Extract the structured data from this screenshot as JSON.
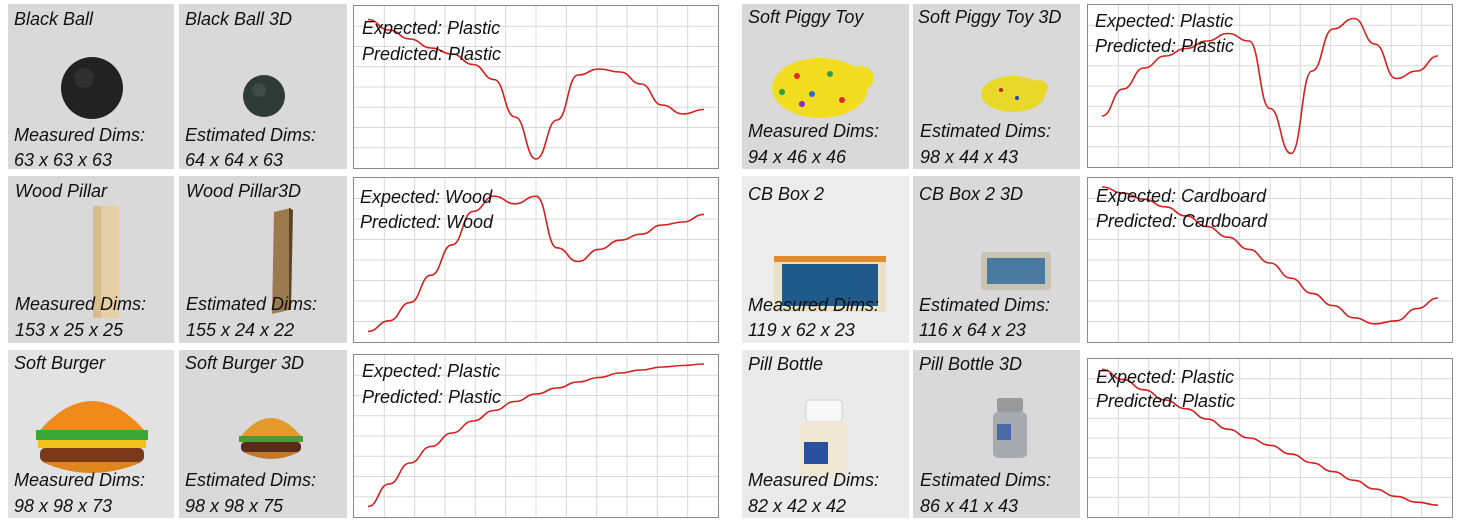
{
  "colors": {
    "curve": "#d42020",
    "grid": "#d8d8d8",
    "tile_bg": "#d9d9d9"
  },
  "rows": [
    {
      "photo": {
        "title": "Black Ball",
        "dims_label": "Measured Dims:",
        "dims": "63 x 63 x 63"
      },
      "recon": {
        "title": "Black Ball 3D",
        "dims_label": "Estimated Dims:",
        "dims": "64 x 64 x 63"
      },
      "chart": {
        "expected": "Expected: Plastic",
        "predicted": "Predicted: Plastic"
      }
    },
    {
      "photo": {
        "title": "Soft Piggy Toy",
        "dims_label": "Measured Dims:",
        "dims": "94 x 46 x 46"
      },
      "recon": {
        "title": "Soft Piggy Toy 3D",
        "dims_label": "Estimated Dims:",
        "dims": "98 x 44 x 43"
      },
      "chart": {
        "expected": "Expected: Plastic",
        "predicted": "Predicted: Plastic"
      }
    },
    {
      "photo": {
        "title": "Wood Pillar",
        "dims_label": "Measured Dims:",
        "dims": "153 x 25 x 25"
      },
      "recon": {
        "title": "Wood Pillar3D",
        "dims_label": "Estimated Dims:",
        "dims": "155 x 24 x 22"
      },
      "chart": {
        "expected": "Expected: Wood",
        "predicted": "Predicted: Wood"
      }
    },
    {
      "photo": {
        "title": "CB Box 2",
        "dims_label": "Measured Dims:",
        "dims": "119 x 62 x 23"
      },
      "recon": {
        "title": "CB Box 2 3D",
        "dims_label": "Estimated Dims:",
        "dims": "116 x 64 x 23"
      },
      "chart": {
        "expected": "Expected: Cardboard",
        "predicted": "Predicted: Cardboard"
      }
    },
    {
      "photo": {
        "title": "Soft Burger",
        "dims_label": "Measured Dims:",
        "dims": "98 x 98 x 73"
      },
      "recon": {
        "title": "Soft Burger 3D",
        "dims_label": "Estimated Dims:",
        "dims": "98 x 98 x 75"
      },
      "chart": {
        "expected": "Expected: Plastic",
        "predicted": "Predicted: Plastic"
      }
    },
    {
      "photo": {
        "title": "Pill Bottle",
        "dims_label": "Measured Dims:",
        "dims": "82 x 42 x 42"
      },
      "recon": {
        "title": "Pill Bottle 3D",
        "dims_label": "Estimated Dims:",
        "dims": "86 x 41 x 43"
      },
      "chart": {
        "expected": "Expected: Plastic",
        "predicted": "Predicted: Plastic"
      }
    }
  ],
  "chart_data": [
    {
      "type": "line",
      "series": [
        {
          "values": [
            0.95,
            0.88,
            0.82,
            0.76,
            0.72,
            0.65,
            0.55,
            0.3,
            0.02,
            0.28,
            0.58,
            0.62,
            0.6,
            0.52,
            0.38,
            0.32,
            0.35
          ]
        }
      ]
    },
    {
      "type": "line",
      "series": [
        {
          "values": [
            0.3,
            0.48,
            0.62,
            0.7,
            0.75,
            0.8,
            0.85,
            0.8,
            0.35,
            0.05,
            0.6,
            0.88,
            0.95,
            0.78,
            0.55,
            0.6,
            0.7
          ]
        }
      ]
    },
    {
      "type": "line",
      "series": [
        {
          "values": [
            0.03,
            0.1,
            0.22,
            0.4,
            0.6,
            0.82,
            0.92,
            0.87,
            0.92,
            0.58,
            0.49,
            0.57,
            0.63,
            0.67,
            0.73,
            0.75,
            0.8
          ]
        }
      ]
    },
    {
      "type": "line",
      "series": [
        {
          "values": [
            0.98,
            0.94,
            0.9,
            0.85,
            0.79,
            0.72,
            0.65,
            0.57,
            0.48,
            0.38,
            0.28,
            0.2,
            0.12,
            0.08,
            0.1,
            0.18,
            0.25
          ]
        }
      ]
    },
    {
      "type": "line",
      "series": [
        {
          "values": [
            0.03,
            0.18,
            0.32,
            0.43,
            0.52,
            0.6,
            0.67,
            0.73,
            0.78,
            0.82,
            0.86,
            0.89,
            0.92,
            0.94,
            0.96,
            0.97,
            0.98
          ]
        }
      ]
    },
    {
      "type": "line",
      "series": [
        {
          "values": [
            0.97,
            0.9,
            0.83,
            0.76,
            0.7,
            0.63,
            0.56,
            0.5,
            0.45,
            0.39,
            0.33,
            0.27,
            0.21,
            0.15,
            0.1,
            0.06,
            0.04
          ]
        }
      ]
    }
  ]
}
